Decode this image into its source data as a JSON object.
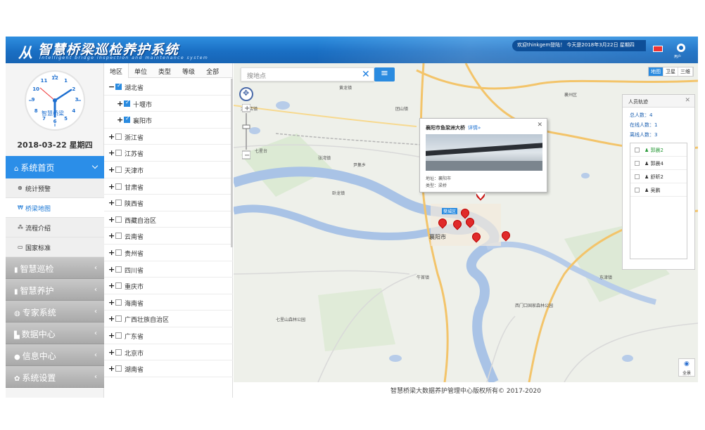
{
  "header": {
    "logo_mark": "从",
    "title": "智慧桥梁巡检养护系统",
    "subtitle": "Intelligent bridge inspection and maintenance system",
    "welcome": "欢迎thinkgem登陆！ 今天是2018年3月22日 星期四",
    "user_label": "用户"
  },
  "sidebar": {
    "clock_brand": "智慧桥梁",
    "clock_numbers": [
      "12",
      "1",
      "2",
      "3",
      "4",
      "5",
      "6",
      "7",
      "8",
      "9",
      "10",
      "11"
    ],
    "date": "2018-03-22 星期四",
    "home": {
      "label": "系统首页",
      "icon": "home-icon"
    },
    "subitems": [
      {
        "label": "统计预警",
        "icon": "target-icon",
        "active": false
      },
      {
        "label": "桥梁地图",
        "icon": "bridge-icon",
        "active": true
      },
      {
        "label": "流程介绍",
        "icon": "flow-icon",
        "active": false
      },
      {
        "label": "国家标准",
        "icon": "monitor-icon",
        "active": false
      }
    ],
    "menus": [
      {
        "label": "智慧巡检",
        "icon": "tablet-icon"
      },
      {
        "label": "智慧养护",
        "icon": "book-icon"
      },
      {
        "label": "专家系统",
        "icon": "globe-icon"
      },
      {
        "label": "数据中心",
        "icon": "chart-icon"
      },
      {
        "label": "信息中心",
        "icon": "chat-icon"
      },
      {
        "label": "系统设置",
        "icon": "gear-icon"
      }
    ]
  },
  "tree": {
    "tabs": [
      "地区",
      "单位",
      "类型",
      "等级",
      "全部"
    ],
    "rows": [
      {
        "label": "湖北省",
        "sign": "−",
        "checked": true,
        "level": 0
      },
      {
        "label": "十堰市",
        "sign": "+",
        "checked": true,
        "level": 1
      },
      {
        "label": "襄阳市",
        "sign": "+",
        "checked": true,
        "level": 1
      },
      {
        "label": "浙江省",
        "sign": "+",
        "checked": false,
        "level": 0
      },
      {
        "label": "江苏省",
        "sign": "+",
        "checked": false,
        "level": 0
      },
      {
        "label": "天津市",
        "sign": "+",
        "checked": false,
        "level": 0
      },
      {
        "label": "甘肃省",
        "sign": "+",
        "checked": false,
        "level": 0
      },
      {
        "label": "陕西省",
        "sign": "+",
        "checked": false,
        "level": 0
      },
      {
        "label": "西藏自治区",
        "sign": "+",
        "checked": false,
        "level": 0
      },
      {
        "label": "云南省",
        "sign": "+",
        "checked": false,
        "level": 0
      },
      {
        "label": "贵州省",
        "sign": "+",
        "checked": false,
        "level": 0
      },
      {
        "label": "四川省",
        "sign": "+",
        "checked": false,
        "level": 0
      },
      {
        "label": "重庆市",
        "sign": "+",
        "checked": false,
        "level": 0
      },
      {
        "label": "海南省",
        "sign": "+",
        "checked": false,
        "level": 0
      },
      {
        "label": "广西壮族自治区",
        "sign": "+",
        "checked": false,
        "level": 0
      },
      {
        "label": "广东省",
        "sign": "+",
        "checked": false,
        "level": 0
      },
      {
        "label": "北京市",
        "sign": "+",
        "checked": false,
        "level": 0
      },
      {
        "label": "湖南省",
        "sign": "+",
        "checked": false,
        "level": 0
      }
    ]
  },
  "map": {
    "search_placeholder": "搜地点",
    "map_types": [
      "地图",
      "卫星",
      "三维"
    ],
    "labels": [
      {
        "text": "樊城区"
      },
      {
        "text": "襄阳市"
      },
      {
        "text": "襄州区"
      },
      {
        "text": "太平店镇"
      },
      {
        "text": "七星台"
      },
      {
        "text": "团山镇"
      },
      {
        "text": "尹集乡"
      },
      {
        "text": "卧龙镇"
      },
      {
        "text": "牛首镇"
      },
      {
        "text": "黄龙镇"
      },
      {
        "text": "东津镇"
      },
      {
        "text": "张湾镇"
      },
      {
        "text": "峪山镇"
      },
      {
        "text": "七里山森林公园"
      },
      {
        "text": "西门口国家森林公园"
      },
      {
        "text": "吕堰镇"
      }
    ],
    "popup": {
      "title": "襄阳市鱼梁洲大桥",
      "detail_link": "详情»",
      "address": "地址：襄阳市",
      "type": "类型：梁桥"
    },
    "panorama_label": "全景"
  },
  "track_panel": {
    "title": "人员轨迹",
    "total": "总人数：4",
    "online": "在线人数：1",
    "offline": "离线人数：3",
    "people": [
      "郭晨2",
      "郭晨4",
      "舒昕2",
      "吴鹏"
    ]
  },
  "footer": {
    "copyright": "智慧桥梁大数据养护管理中心版权所有© 2017-2020"
  }
}
